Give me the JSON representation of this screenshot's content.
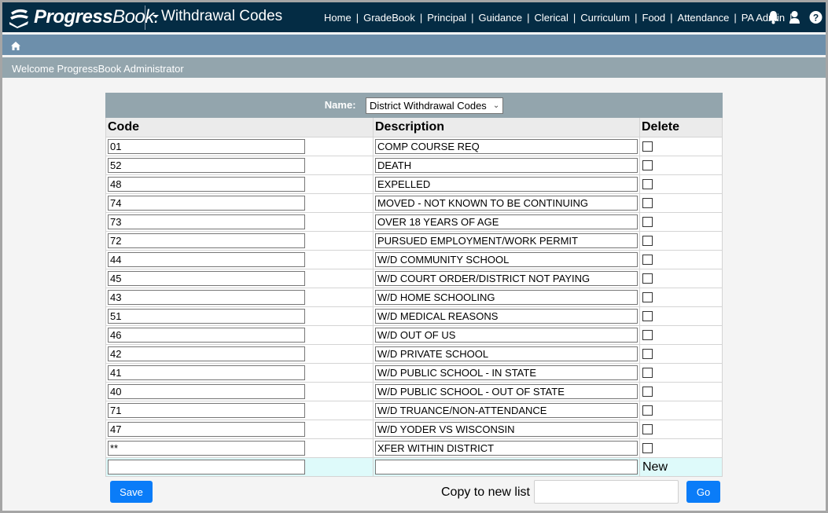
{
  "header": {
    "logo_bold": "Progress",
    "logo_light": "Book.",
    "page_title": "Withdrawal Codes",
    "nav": [
      "Home",
      "GradeBook",
      "Principal",
      "Guidance",
      "Clerical",
      "Curriculum",
      "Food",
      "Attendance",
      "PA Admin"
    ],
    "icons": [
      "bell-icon",
      "user-icon",
      "help-icon"
    ]
  },
  "breadcrumb": {
    "icon": "home-icon"
  },
  "welcome": "Welcome ProgressBook Administrator",
  "table": {
    "name_label": "Name:",
    "name_selected": "District Withdrawal Codes",
    "columns": [
      "Code",
      "Description",
      "Delete"
    ],
    "rows": [
      {
        "code": "01",
        "description": "COMP COURSE REQ",
        "delete": false
      },
      {
        "code": "52",
        "description": "DEATH",
        "delete": false
      },
      {
        "code": "48",
        "description": "EXPELLED",
        "delete": false
      },
      {
        "code": "74",
        "description": "MOVED - NOT KNOWN TO BE CONTINUING",
        "delete": false
      },
      {
        "code": "73",
        "description": "OVER 18 YEARS OF AGE",
        "delete": false
      },
      {
        "code": "72",
        "description": "PURSUED EMPLOYMENT/WORK PERMIT",
        "delete": false
      },
      {
        "code": "44",
        "description": "W/D COMMUNITY SCHOOL",
        "delete": false
      },
      {
        "code": "45",
        "description": "W/D COURT ORDER/DISTRICT NOT PAYING",
        "delete": false
      },
      {
        "code": "43",
        "description": "W/D HOME SCHOOLING",
        "delete": false
      },
      {
        "code": "51",
        "description": "W/D MEDICAL REASONS",
        "delete": false
      },
      {
        "code": "46",
        "description": "W/D OUT OF US",
        "delete": false
      },
      {
        "code": "42",
        "description": "W/D PRIVATE SCHOOL",
        "delete": false
      },
      {
        "code": "41",
        "description": "W/D PUBLIC SCHOOL - IN STATE",
        "delete": false
      },
      {
        "code": "40",
        "description": "W/D PUBLIC SCHOOL - OUT OF STATE",
        "delete": false
      },
      {
        "code": "71",
        "description": "W/D TRUANCE/NON-ATTENDANCE",
        "delete": false
      },
      {
        "code": "47",
        "description": "W/D YODER VS WISCONSIN",
        "delete": false
      },
      {
        "code": "**",
        "description": "XFER WITHIN DISTRICT",
        "delete": false
      }
    ],
    "new_row": {
      "code": "",
      "description": "",
      "label": "New"
    }
  },
  "footer": {
    "save_label": "Save",
    "copy_label": "Copy to new list",
    "copy_value": "",
    "go_label": "Go"
  },
  "colors": {
    "topbar": "#042c44",
    "breadcrumb_bar": "#6d8fab",
    "welcome_bar": "#93a5ad",
    "button": "#0a7cf8",
    "new_row": "#defafa"
  }
}
